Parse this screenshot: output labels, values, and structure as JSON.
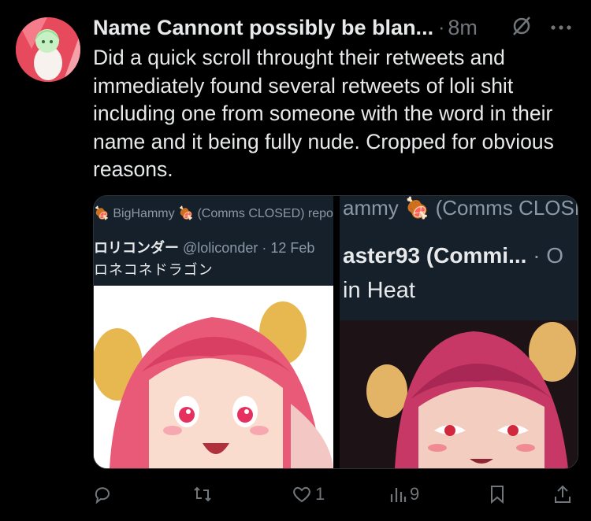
{
  "tweet": {
    "author_name": "Name Cannont possibly be blan...",
    "separator": "·",
    "time": "8m",
    "text": "Did a quick scroll throught their retweets and immediately found several retweets of loli shit including one from someone with the word in their name and it being fully nude. Cropped for obvious reasons."
  },
  "media": {
    "left": {
      "repost_prefix": "BigHammy",
      "repost_suffix": "(Comms CLOSED) repos",
      "author_name": "ロリコンダー",
      "author_meta": "@loliconder · 12 Feb",
      "text": "ロネコネドラゴン"
    },
    "right": {
      "line1_prefix": "ammy",
      "line1_suffix": "(Comms CLOSE",
      "line2": "aster93 (Commi...",
      "line2_meta": " · O",
      "line3": "in Heat"
    }
  },
  "actions": {
    "reply_count": "",
    "repost_count": "",
    "like_count": "1",
    "views_count": "9"
  },
  "icons": [
    "avatar",
    "grok-icon",
    "more-icon",
    "meat-emoji",
    "reply-icon",
    "repost-icon",
    "like-icon",
    "views-icon",
    "bookmark-icon",
    "share-icon"
  ]
}
